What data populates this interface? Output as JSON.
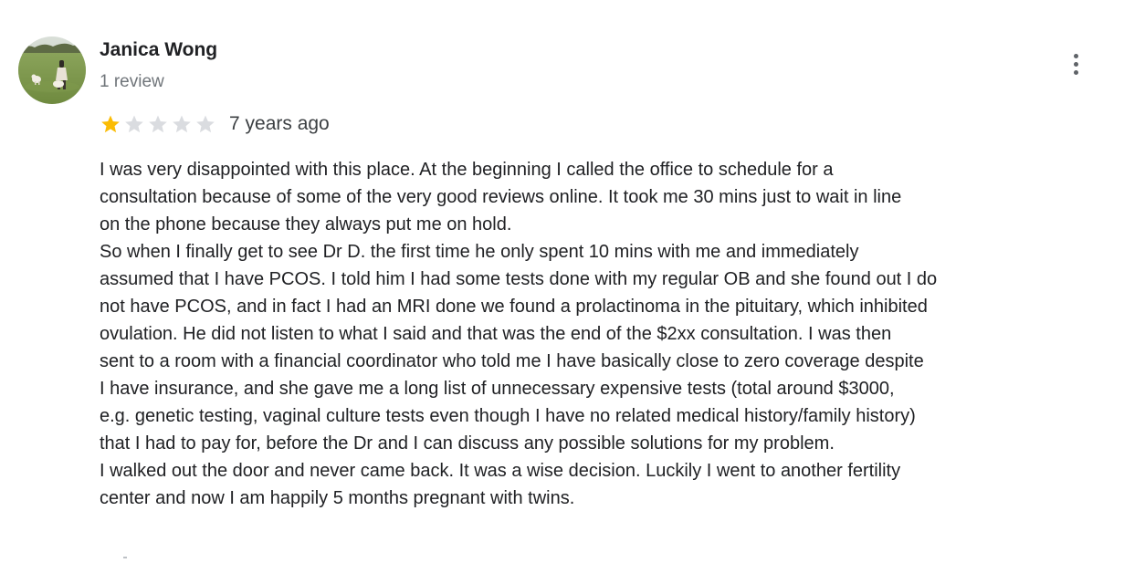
{
  "reviewer": {
    "name": "Janica Wong",
    "review_count": "1 review"
  },
  "rating": {
    "stars_filled": 1,
    "stars_total": 5,
    "filled_color": "#fbbc04",
    "empty_color": "#dadce0",
    "date": "7 years ago"
  },
  "more_options_icon": "more-vert-icon",
  "review_lines": [
    "I was very disappointed with this place. At the beginning I called the office to schedule for  a",
    "consultation because of some of the very good reviews online. It took me 30 mins just to wait in line",
    "on the phone because they always put me on hold.",
    "So when I finally get to see Dr D. the first time he only spent 10 mins with me and immediately",
    "assumed that I have PCOS. I told him I had some tests done with my regular OB and she found out I do",
    "not have PCOS, and in fact I had an MRI done we found a prolactinoma in the pituitary, which inhibited",
    "ovulation. He did not listen to what I said and that was the end of the $2xx consultation. I was then",
    "sent to a room with a financial coordinator who told me I have basically close to zero coverage despite",
    "I have insurance, and she gave me a long list of unnecessary expensive tests (total around $3000,",
    "e.g. genetic testing, vaginal culture tests even though I have no related medical history/family history)",
    "that I had to pay for, before the Dr and I can discuss any possible solutions for my problem.",
    "I walked out the door and never came back. It was a wise decision. Luckily I went to another fertility",
    "center and now I am happily 5 months pregnant with twins."
  ]
}
